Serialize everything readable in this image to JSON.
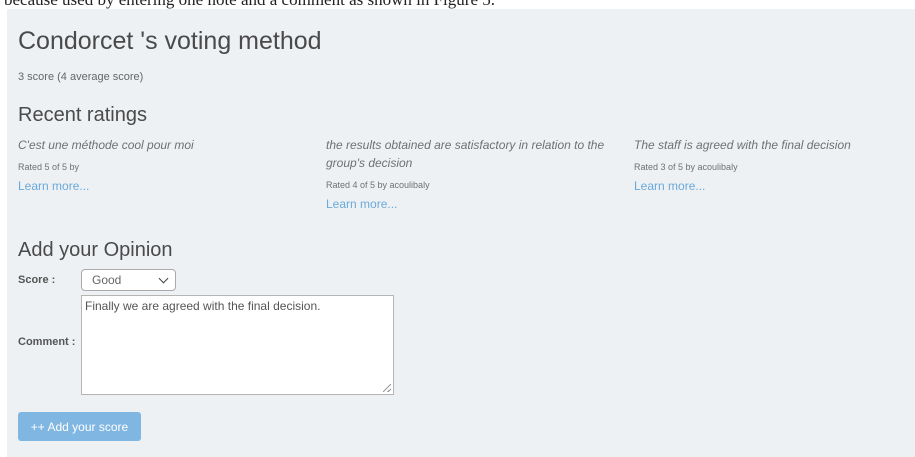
{
  "caption": "because used by entering one note and a comment as shown in Figure 5.",
  "page": {
    "title": "Condorcet 's voting method",
    "average_score": "3 score (4 average score)"
  },
  "recent_ratings": {
    "heading": "Recent ratings",
    "items": [
      {
        "comment": "C'est une méthode cool pour moi",
        "meta": "Rated 5 of 5 by",
        "link": "Learn more..."
      },
      {
        "comment": "the results obtained are satisfactory in relation to the group's decision",
        "meta": "Rated 4 of 5 by acoulibaly",
        "link": "Learn more..."
      },
      {
        "comment": "The staff is agreed with the final decision",
        "meta": "Rated 3 of 5 by acoulibaly",
        "link": "Learn more..."
      }
    ]
  },
  "opinion_form": {
    "heading": "Add your Opinion",
    "score_label": "Score :",
    "score_value": "Good",
    "comment_label": "Comment :",
    "comment_value": "Finally we are agreed with the final decision.",
    "submit_label": "++ Add your score"
  },
  "colors": {
    "panel_bg": "#eef1f4",
    "link": "#6aa9d8",
    "button_bg": "#7fb6e2"
  }
}
